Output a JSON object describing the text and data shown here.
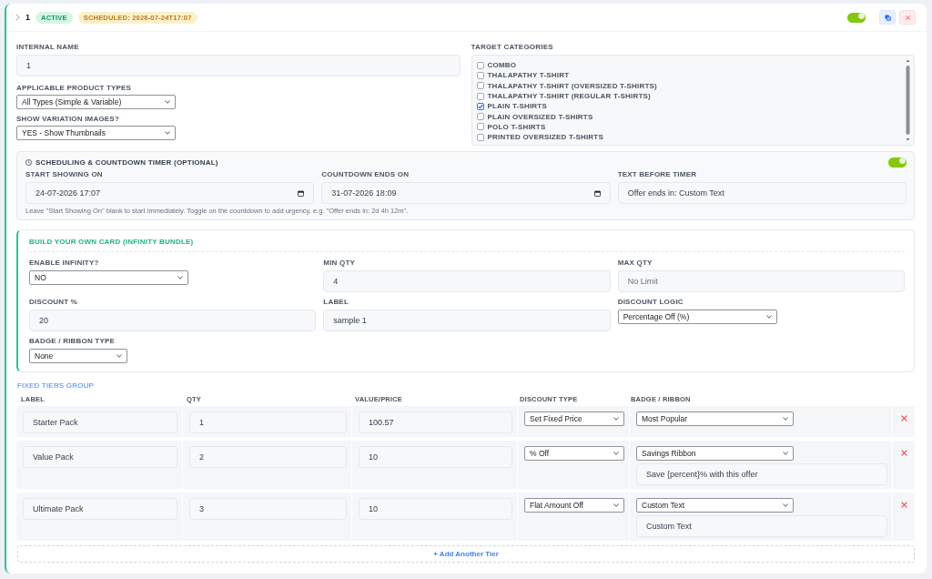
{
  "bundle": {
    "number": "1",
    "enabled": true,
    "badges": [
      {
        "kind": "active",
        "label": "ACTIVE"
      },
      {
        "kind": "scheduled",
        "label": "SCHEDULED: 2026-07-24T17:07"
      }
    ]
  },
  "general": {
    "fields": [
      {
        "kind": "text",
        "label": "INTERNAL NAME",
        "value": "1"
      },
      {
        "kind": "select",
        "label": "APPLICABLE PRODUCT TYPES",
        "value": "All Types (Simple & Variable)"
      },
      {
        "kind": "select",
        "label": "SHOW VARIATION IMAGES?",
        "value": "YES - Show Thumbnails"
      }
    ],
    "target_categories": {
      "label": "TARGET CATEGORIES",
      "items": [
        {
          "label": "COMBO",
          "checked": false
        },
        {
          "label": "THALAPATHY T-SHIRT",
          "checked": false
        },
        {
          "label": "THALAPATHY T-SHIRT (OVERSIZED T-SHIRTS)",
          "checked": false
        },
        {
          "label": "THALAPATHY T-SHIRT (REGULAR T-SHIRTS)",
          "checked": false
        },
        {
          "label": "PLAIN T-SHIRTS",
          "checked": true
        },
        {
          "label": "PLAIN OVERSIZED T-SHIRTS",
          "checked": false
        },
        {
          "label": "POLO T-SHIRTS",
          "checked": false
        },
        {
          "label": "PRINTED OVERSIZED T-SHIRTS",
          "checked": false
        }
      ]
    }
  },
  "scheduling": {
    "title": "SCHEDULING & COUNTDOWN TIMER (OPTIONAL)",
    "countdown_on": true,
    "fields": [
      {
        "kind": "date",
        "label": "START SHOWING ON",
        "value": "24-07-2026 17:07"
      },
      {
        "kind": "date",
        "label": "COUNTDOWN ENDS ON",
        "value": "31-07-2026 18:09"
      },
      {
        "kind": "text",
        "label": "TEXT BEFORE TIMER",
        "value": "Offer ends in: Custom Text"
      }
    ],
    "help": "Leave \"Start Showing On\" blank to start immediately. Toggle on the countdown to add urgency, e.g. \"Offer ends in: 2d 4h 12m\"."
  },
  "infinity_bundle": {
    "title": "BUILD YOUR OWN CARD (INFINITY BUNDLE)",
    "fields": [
      {
        "kind": "select",
        "label": "ENABLE INFINITY?",
        "value": "NO"
      },
      {
        "kind": "text",
        "label": "MIN QTY",
        "value": "4"
      },
      {
        "kind": "text",
        "label": "MAX QTY",
        "placeholder": "No Limit"
      },
      {
        "kind": "text",
        "label": "DISCOUNT %",
        "value": "20"
      },
      {
        "kind": "text",
        "label": "LABEL",
        "value": "sample 1"
      },
      {
        "kind": "select",
        "label": "DISCOUNT LOGIC",
        "value": "Percentage Off (%)"
      },
      {
        "kind": "select",
        "label": "BADGE / RIBBON TYPE",
        "value": "None"
      }
    ]
  },
  "fixed_tiers": {
    "title": "FIXED TIERS GROUP",
    "columns": [
      "LABEL",
      "QTY",
      "VALUE/PRICE",
      "DISCOUNT TYPE",
      "BADGE / RIBBON"
    ],
    "rows": [
      {
        "label": "Starter Pack",
        "qty": "1",
        "value": "100.57",
        "discount_type": "Set Fixed Price",
        "badge": "Most Popular"
      },
      {
        "label": "Value Pack",
        "qty": "2",
        "value": "10",
        "discount_type": "% Off",
        "badge": "Savings Ribbon",
        "badge_text": "Save {percent}% with this offer"
      },
      {
        "label": "Ultimate Pack",
        "qty": "3",
        "value": "10",
        "discount_type": "Flat Amount Off",
        "badge": "Custom Text",
        "badge_text": "Custom Text"
      }
    ],
    "add_button": "+ Add Another Tier"
  }
}
